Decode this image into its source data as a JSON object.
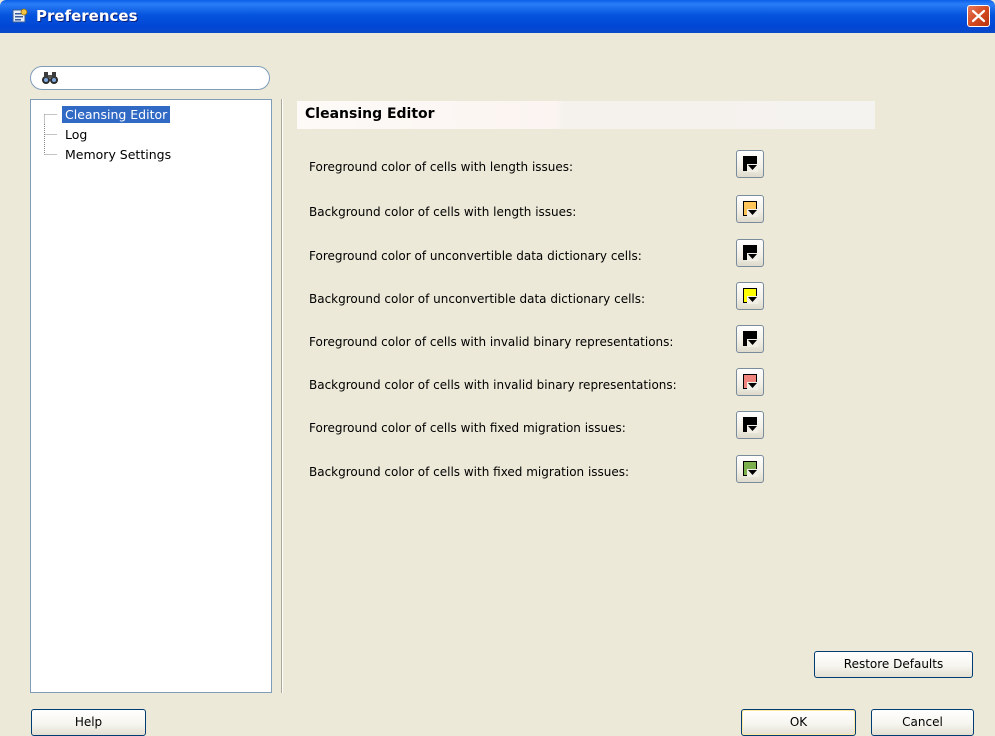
{
  "window": {
    "title": "Preferences"
  },
  "search": {
    "value": "",
    "placeholder": ""
  },
  "tree": {
    "items": [
      {
        "label": "Cleansing Editor",
        "selected": true
      },
      {
        "label": "Log",
        "selected": false
      },
      {
        "label": "Memory Settings",
        "selected": false
      }
    ]
  },
  "panel": {
    "title": "Cleansing Editor",
    "rows": [
      {
        "label": "Foreground color of cells with length issues:",
        "color": "#000000"
      },
      {
        "label": "Background color of cells with length issues:",
        "color": "#FDC55A"
      },
      {
        "label": "Foreground color of unconvertible data dictionary cells:",
        "color": "#000000"
      },
      {
        "label": "Background color of unconvertible data dictionary cells:",
        "color": "#FFFF00"
      },
      {
        "label": "Foreground color of cells with invalid binary representations:",
        "color": "#000000"
      },
      {
        "label": "Background color of cells with invalid binary representations:",
        "color": "#F0857D"
      },
      {
        "label": "Foreground color of cells with fixed migration issues:",
        "color": "#000000"
      },
      {
        "label": "Background color of cells with fixed migration issues:",
        "color": "#7CB04E"
      }
    ]
  },
  "buttons": {
    "restore_defaults": "Restore Defaults",
    "help": "Help",
    "ok": "OK",
    "cancel": "Cancel"
  },
  "colors": {
    "title_bar": "#0055E5",
    "selection": "#316AC5",
    "dialog_bg": "#ECE9D8"
  }
}
